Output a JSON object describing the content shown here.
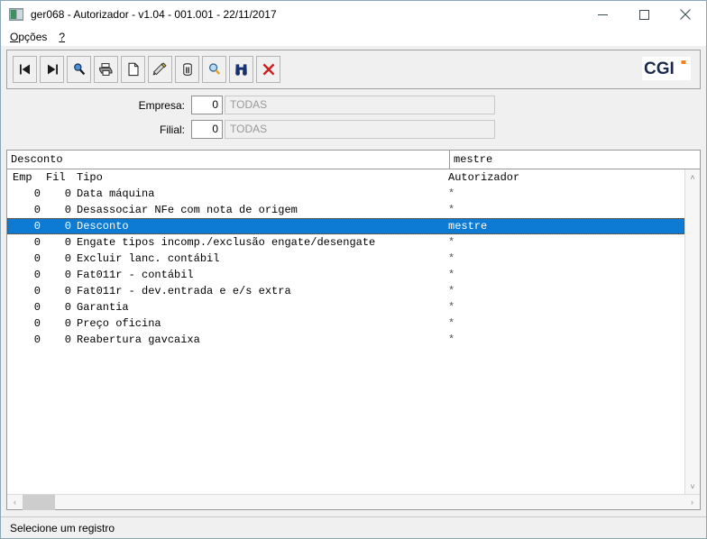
{
  "window": {
    "title": "ger068 - Autorizador - v1.04 - 001.001 - 22/11/2017",
    "app_icon": "app-window-icon",
    "minimize_label": "–",
    "maximize_label": "□",
    "close_label": "✕",
    "border_color": "#8aa7b5"
  },
  "menubar": {
    "items": [
      {
        "mnemonic": "O",
        "rest": "pções",
        "name": "menu-opcoes"
      },
      {
        "mnemonic": "?",
        "rest": "",
        "name": "menu-help"
      }
    ]
  },
  "toolbar": {
    "buttons": [
      {
        "name": "first-record-icon",
        "tip": "Primeiro"
      },
      {
        "name": "last-record-icon",
        "tip": "Último"
      },
      {
        "name": "search-icon",
        "tip": "Pesquisar"
      },
      {
        "name": "print-icon",
        "tip": "Imprimir"
      },
      {
        "name": "new-document-icon",
        "tip": "Novo"
      },
      {
        "name": "edit-pencil-icon",
        "tip": "Alterar"
      },
      {
        "name": "trash-delete-icon",
        "tip": "Excluir"
      },
      {
        "name": "zoom-query-icon",
        "tip": "Consultar"
      },
      {
        "name": "binoculars-find-icon",
        "tip": "Localizar"
      },
      {
        "name": "close-x-icon",
        "tip": "Fechar"
      }
    ],
    "logo_text": "CGI",
    "logo_color": "#1b2a4a",
    "logo_accent": "#f58220"
  },
  "form": {
    "fields": [
      {
        "label": "Empresa:",
        "value": "0",
        "description": "TODAS",
        "name_num": "empresa-code-input",
        "name_desc": "empresa-description-field"
      },
      {
        "label": "Filial:",
        "value": "0",
        "description": "TODAS",
        "name_num": "filial-code-input",
        "name_desc": "filial-description-field"
      }
    ]
  },
  "grid": {
    "group_header": {
      "left": "Desconto",
      "right": "mestre"
    },
    "columns": {
      "emp": "Emp",
      "fil": "Fil",
      "tipo": "Tipo",
      "autorizador": "Autorizador"
    },
    "rows": [
      {
        "emp": "0",
        "fil": "0",
        "tipo": "Data máquina",
        "autorizador": "*",
        "selected": false
      },
      {
        "emp": "0",
        "fil": "0",
        "tipo": "Desassociar NFe com nota de origem",
        "autorizador": "*",
        "selected": false
      },
      {
        "emp": "0",
        "fil": "0",
        "tipo": "Desconto",
        "autorizador": "mestre",
        "selected": true
      },
      {
        "emp": "0",
        "fil": "0",
        "tipo": "Engate tipos incomp./exclusão engate/desengate",
        "autorizador": "*",
        "selected": false
      },
      {
        "emp": "0",
        "fil": "0",
        "tipo": "Excluir lanc. contábil",
        "autorizador": "*",
        "selected": false
      },
      {
        "emp": "0",
        "fil": "0",
        "tipo": "Fat011r - contábil",
        "autorizador": "*",
        "selected": false
      },
      {
        "emp": "0",
        "fil": "0",
        "tipo": "Fat011r - dev.entrada e e/s extra",
        "autorizador": "*",
        "selected": false
      },
      {
        "emp": "0",
        "fil": "0",
        "tipo": "Garantia",
        "autorizador": "*",
        "selected": false
      },
      {
        "emp": "0",
        "fil": "0",
        "tipo": "Preço oficina",
        "autorizador": "*",
        "selected": false
      },
      {
        "emp": "0",
        "fil": "0",
        "tipo": "Reabertura gavcaixa",
        "autorizador": "*",
        "selected": false
      }
    ],
    "selection_color": "#0d7bd4",
    "scroll_up": "˄",
    "scroll_down": "˅",
    "scroll_left": "‹",
    "scroll_right": "›"
  },
  "statusbar": {
    "message": "Selecione um registro"
  }
}
